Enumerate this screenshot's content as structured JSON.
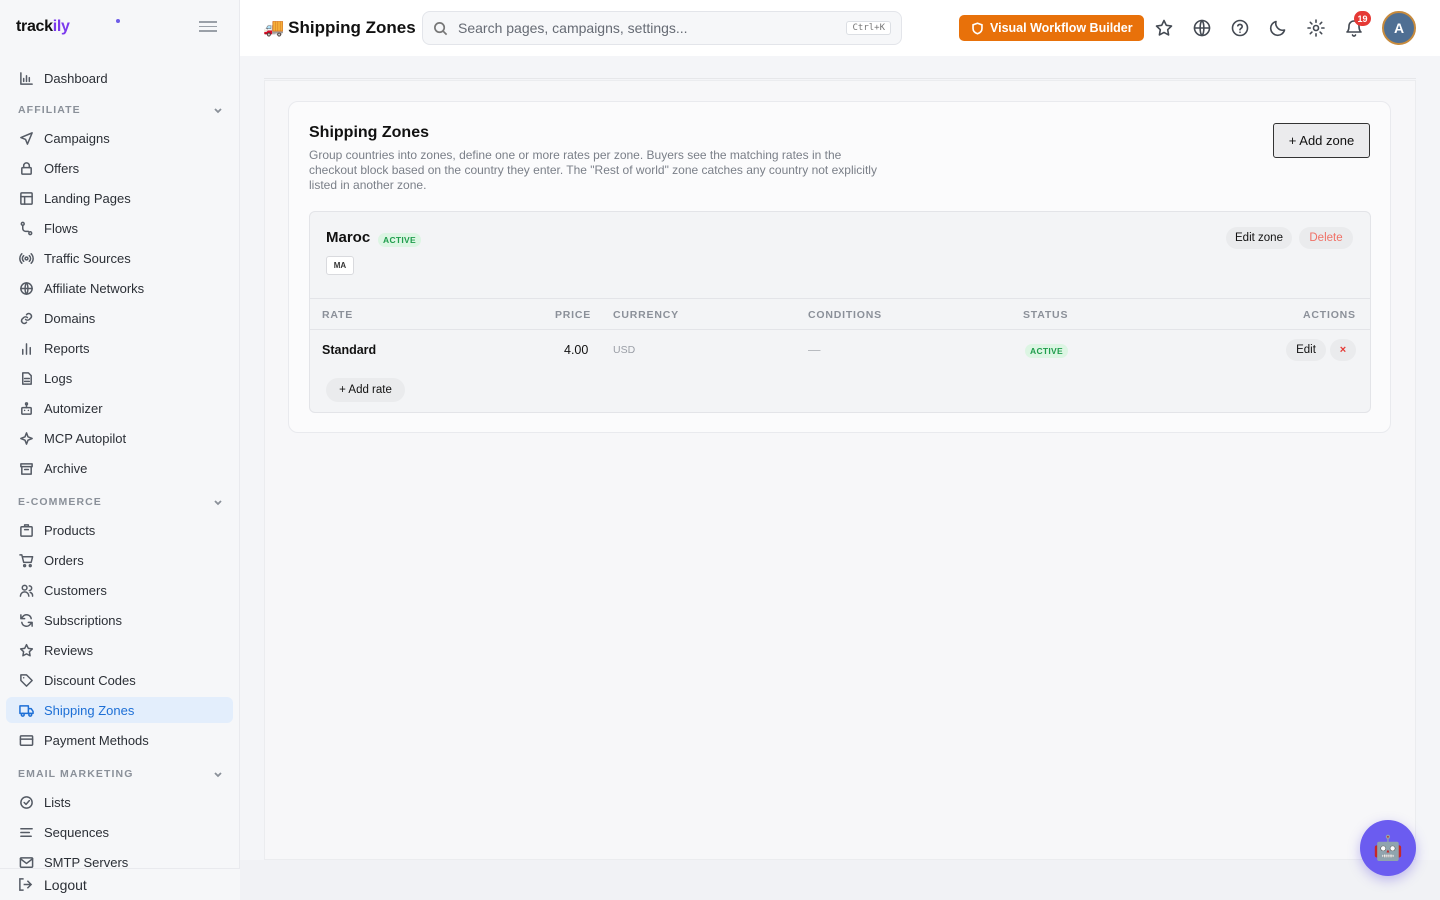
{
  "brand": {
    "name_main": "track",
    "name_accent": "ily"
  },
  "sidebar": {
    "items_top": [
      {
        "label": "Dashboard",
        "icon": "chart-icon"
      }
    ],
    "sections": [
      {
        "title": "AFFILIATE",
        "items": [
          {
            "label": "Campaigns",
            "icon": "send-icon"
          },
          {
            "label": "Offers",
            "icon": "lock-icon"
          },
          {
            "label": "Landing Pages",
            "icon": "layout-icon"
          },
          {
            "label": "Flows",
            "icon": "route-icon"
          },
          {
            "label": "Traffic Sources",
            "icon": "radio-icon"
          },
          {
            "label": "Affiliate Networks",
            "icon": "globe-icon"
          },
          {
            "label": "Domains",
            "icon": "link-icon"
          },
          {
            "label": "Reports",
            "icon": "bar-chart-icon"
          },
          {
            "label": "Logs",
            "icon": "file-icon"
          },
          {
            "label": "Automizer",
            "icon": "bot-icon"
          },
          {
            "label": "MCP Autopilot",
            "icon": "sparkle-icon"
          },
          {
            "label": "Archive",
            "icon": "archive-icon"
          }
        ]
      },
      {
        "title": "E-COMMERCE",
        "items": [
          {
            "label": "Products",
            "icon": "box-icon"
          },
          {
            "label": "Orders",
            "icon": "cart-icon"
          },
          {
            "label": "Customers",
            "icon": "users-icon"
          },
          {
            "label": "Subscriptions",
            "icon": "refresh-icon"
          },
          {
            "label": "Reviews",
            "icon": "star-icon"
          },
          {
            "label": "Discount Codes",
            "icon": "tag-icon"
          },
          {
            "label": "Shipping Zones",
            "icon": "truck-icon",
            "active": true
          },
          {
            "label": "Payment Methods",
            "icon": "credit-card-icon"
          }
        ]
      },
      {
        "title": "EMAIL MARKETING",
        "items": [
          {
            "label": "Lists",
            "icon": "check-circle-icon"
          },
          {
            "label": "Sequences",
            "icon": "lines-icon"
          },
          {
            "label": "SMTP Servers",
            "icon": "mail-icon"
          }
        ]
      }
    ],
    "logout_label": "Logout"
  },
  "header": {
    "title_emoji": "🚚",
    "title": "Shipping Zones",
    "search_placeholder": "Search pages, campaigns, settings...",
    "search_shortcut": "Ctrl+K",
    "workflow_button": "Visual Workflow Builder",
    "notification_count": "19",
    "avatar_initial": "A"
  },
  "card": {
    "title": "Shipping Zones",
    "description": "Group countries into zones, define one or more rates per zone. Buyers see the matching rates in the checkout block based on the country they enter. The \"Rest of world\" zone catches any country not explicitly listed in another zone.",
    "add_zone_label": "+ Add zone"
  },
  "zone": {
    "name": "Maroc",
    "status": "ACTIVE",
    "country_code": "MA",
    "edit_label": "Edit zone",
    "delete_label": "Delete",
    "columns": [
      "RATE",
      "PRICE",
      "CURRENCY",
      "CONDITIONS",
      "STATUS",
      "ACTIONS"
    ],
    "rates": [
      {
        "rate": "Standard",
        "price": "4.00",
        "currency": "USD",
        "conditions": "—",
        "status": "ACTIVE",
        "edit_label": "Edit",
        "remove_label": "×"
      }
    ],
    "add_rate_label": "+ Add rate"
  },
  "assistant_icon": "🤖",
  "colors": {
    "accent": "#1d6fd6",
    "workflow": "#e8710a",
    "active_green": "#1f9d4c",
    "delete_red": "#f07167"
  }
}
